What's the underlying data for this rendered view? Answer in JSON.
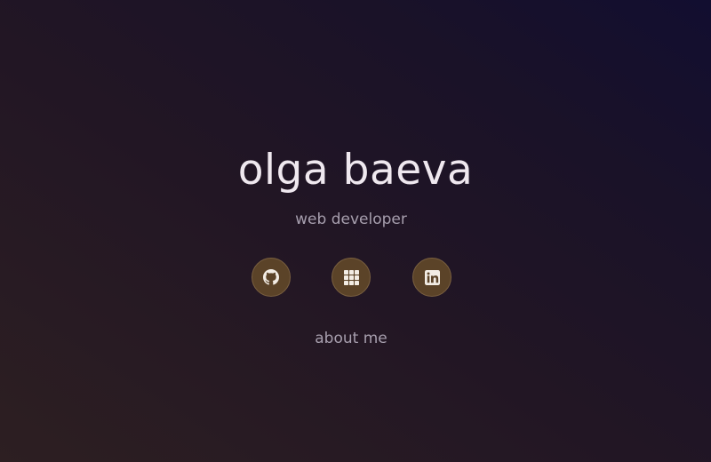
{
  "hero": {
    "name": "olga baeva",
    "role": "web developer"
  },
  "social": [
    {
      "icon": "github-icon",
      "label": "GitHub"
    },
    {
      "icon": "grid-apps-icon",
      "label": "Projects"
    },
    {
      "icon": "linkedin-icon",
      "label": "LinkedIn"
    }
  ],
  "nav": {
    "about_label": "about me"
  },
  "colors": {
    "accent": "#5b4328",
    "title_text": "#efe8ef",
    "muted_text": "#a79fae"
  }
}
